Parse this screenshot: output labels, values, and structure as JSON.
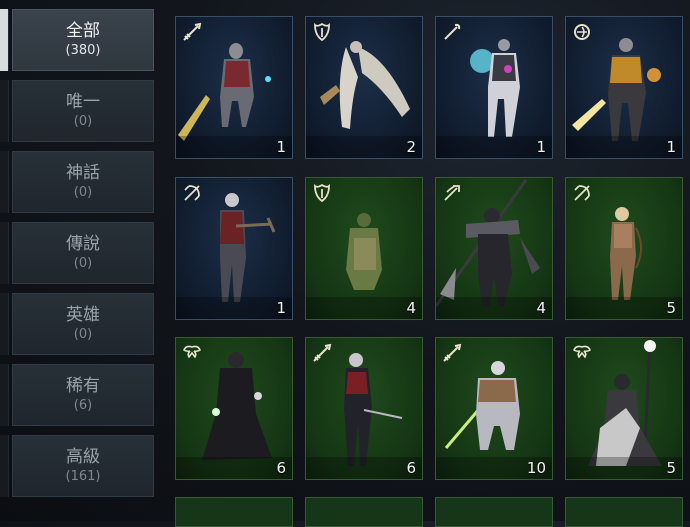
{
  "sidebar": {
    "items": [
      {
        "label": "全部",
        "count": "(380)",
        "active": true
      },
      {
        "label": "唯一",
        "count": "(0)"
      },
      {
        "label": "神話",
        "count": "(0)"
      },
      {
        "label": "傳說",
        "count": "(0)"
      },
      {
        "label": "英雄",
        "count": "(0)"
      },
      {
        "label": "稀有",
        "count": "(6)"
      },
      {
        "label": "高級",
        "count": "(161)"
      }
    ]
  },
  "cards": [
    {
      "class_icon": "sword-class-icon",
      "count": "1",
      "rarity": "rare",
      "figure": "armored-knight-glowing-sword"
    },
    {
      "class_icon": "shield-class-icon",
      "count": "2",
      "rarity": "rare",
      "figure": "winged-creature"
    },
    {
      "class_icon": "staff-class-icon",
      "count": "1",
      "rarity": "rare",
      "figure": "glowing-mage"
    },
    {
      "class_icon": "orb-class-icon",
      "count": "1",
      "rarity": "rare",
      "figure": "golden-armored-knight"
    },
    {
      "class_icon": "bow-class-icon",
      "count": "1",
      "rarity": "rare",
      "figure": "crossbow-archer"
    },
    {
      "class_icon": "shield-class-icon",
      "count": "4",
      "rarity": "advanced",
      "figure": "goblin-warrior"
    },
    {
      "class_icon": "spear-class-icon",
      "count": "4",
      "rarity": "advanced",
      "figure": "dark-spear-knight"
    },
    {
      "class_icon": "bow-class-icon",
      "count": "5",
      "rarity": "advanced",
      "figure": "elf-archer"
    },
    {
      "class_icon": "wing-class-icon",
      "count": "6",
      "rarity": "advanced",
      "figure": "dark-sorceress"
    },
    {
      "class_icon": "sword-class-icon",
      "count": "6",
      "rarity": "advanced",
      "figure": "dark-elf-assassin"
    },
    {
      "class_icon": "sword-class-icon",
      "count": "10",
      "rarity": "advanced",
      "figure": "armored-swordsman"
    },
    {
      "class_icon": "wing-class-icon",
      "count": "5",
      "rarity": "advanced",
      "figure": "robed-staff-caster"
    }
  ],
  "colors": {
    "rare_bg": "#142640",
    "advanced_bg": "#1a401a",
    "active_tab": "#d9dcdf",
    "icon": "#e8e2c8"
  }
}
